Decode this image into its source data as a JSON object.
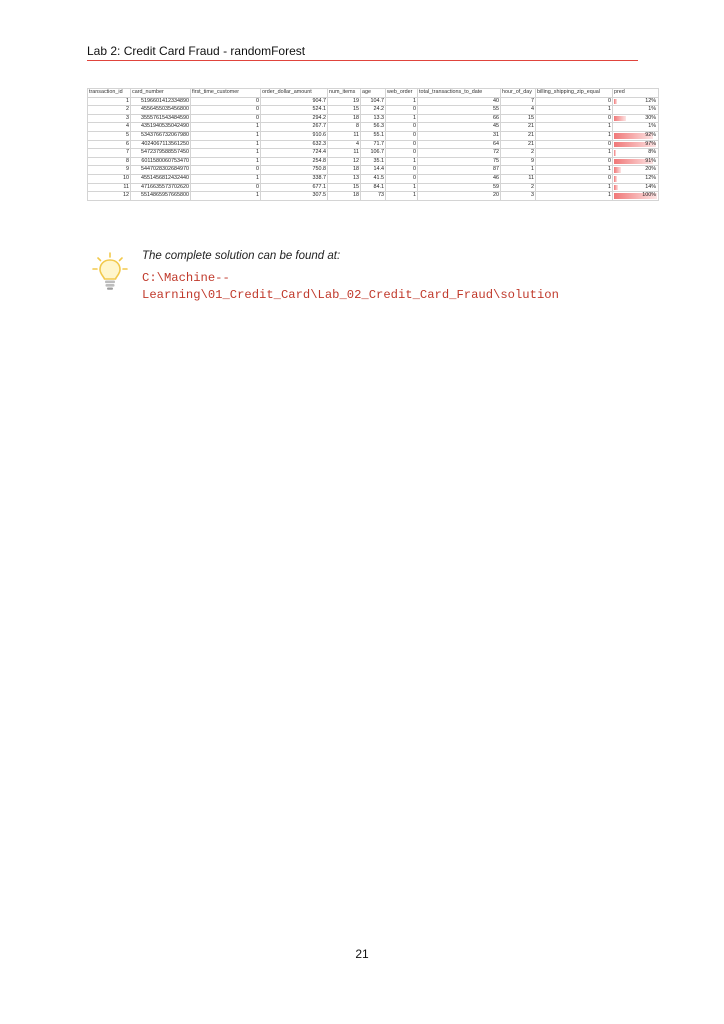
{
  "header": {
    "title": "Lab 2: Credit Card Fraud - randomForest"
  },
  "sheet": {
    "columns": [
      "transaction_id",
      "card_number",
      "first_time_customer",
      "order_dollar_amount",
      "num_items",
      "age",
      "web_order",
      "total_transactions_to_date",
      "hour_of_day",
      "billing_shipping_zip_equal",
      "pred"
    ],
    "rows": [
      [
        "1",
        "5196601412334890",
        "0",
        "904.7",
        "19",
        "104.7",
        "1",
        "40",
        "7",
        "0",
        "12%"
      ],
      [
        "2",
        "4556455035456800",
        "0",
        "524.1",
        "15",
        "24.2",
        "0",
        "55",
        "4",
        "1",
        "1%"
      ],
      [
        "3",
        "3555761543484590",
        "0",
        "294.2",
        "18",
        "13.3",
        "1",
        "66",
        "15",
        "0",
        "30%"
      ],
      [
        "4",
        "4351940535042490",
        "1",
        "267.7",
        "8",
        "56.3",
        "0",
        "45",
        "21",
        "1",
        "1%"
      ],
      [
        "5",
        "5343766732067980",
        "1",
        "910.6",
        "11",
        "55.1",
        "0",
        "31",
        "21",
        "1",
        "92%"
      ],
      [
        "6",
        "4024067113561250",
        "1",
        "632.3",
        "4",
        "71.7",
        "0",
        "64",
        "21",
        "0",
        "97%"
      ],
      [
        "7",
        "5472379588557450",
        "1",
        "724.4",
        "11",
        "106.7",
        "0",
        "72",
        "2",
        "1",
        "8%"
      ],
      [
        "8",
        "6011580060753470",
        "1",
        "254.8",
        "12",
        "35.1",
        "1",
        "75",
        "9",
        "0",
        "91%"
      ],
      [
        "9",
        "5447028302684970",
        "0",
        "750.8",
        "18",
        "14.4",
        "0",
        "87",
        "1",
        "1",
        "20%"
      ],
      [
        "10",
        "4551456812432440",
        "1",
        "338.7",
        "13",
        "41.5",
        "0",
        "46",
        "11",
        "0",
        "12%"
      ],
      [
        "11",
        "4716635573702620",
        "0",
        "677.1",
        "15",
        "84.1",
        "1",
        "59",
        "2",
        "1",
        "14%"
      ],
      [
        "12",
        "5514865957665800",
        "1",
        "307.5",
        "18",
        "73",
        "1",
        "20",
        "3",
        "1",
        "100%"
      ]
    ],
    "pred_values": [
      0.12,
      0.01,
      0.3,
      0.01,
      0.92,
      0.97,
      0.08,
      0.91,
      0.2,
      0.12,
      0.14,
      1.0
    ],
    "bar_color": "#f07878"
  },
  "tip": {
    "icon": "lightbulb-icon",
    "lead": "The complete solution can be found at:",
    "path_line1": "C:\\Machine--",
    "path_line2": "Learning\\01_Credit_Card\\Lab_02_Credit_Card_Fraud\\solution",
    "path_color": "#c0392b"
  },
  "footer": {
    "page_number": "21"
  }
}
